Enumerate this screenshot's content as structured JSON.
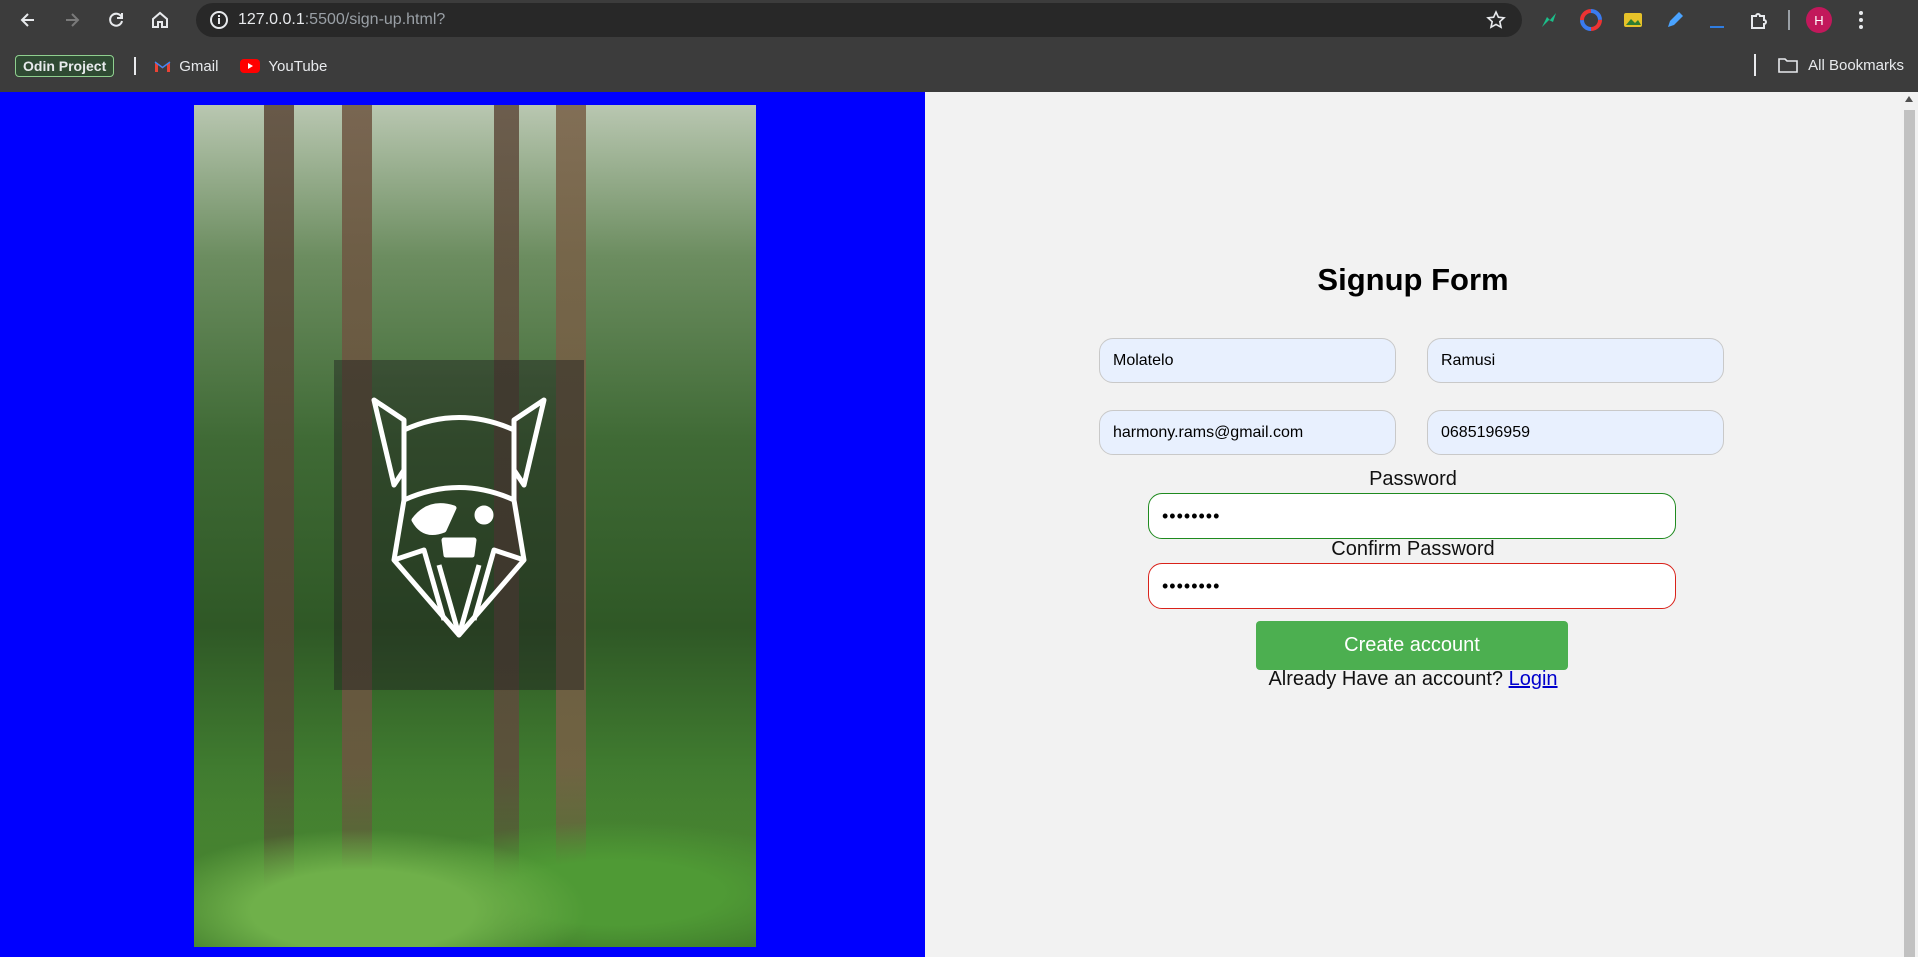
{
  "browser": {
    "url_host": "127.0.0.1",
    "url_path": ":5500/sign-up.html?",
    "avatar_letter": "H"
  },
  "bookmarks": {
    "items": [
      {
        "label": "Odin Project"
      },
      {
        "label": "Gmail"
      },
      {
        "label": "YouTube"
      }
    ],
    "all_bookmarks": "All Bookmarks"
  },
  "colors": {
    "left_background": "#0000ff",
    "right_background": "#f2f2f2",
    "button": "#4caf50",
    "valid_border": "#1f8a1f",
    "invalid_border": "#d9221a"
  },
  "form": {
    "title": "Signup Form",
    "first_name": "Molatelo",
    "last_name": "Ramusi",
    "email": "harmony.rams@gmail.com",
    "phone": "0685196959",
    "password_label": "Password",
    "password_value": "••••••••",
    "confirm_label": "Confirm Password",
    "confirm_value": "••••••••",
    "submit_label": "Create account",
    "login_prompt": "Already Have an account?",
    "login_link": "Login"
  }
}
